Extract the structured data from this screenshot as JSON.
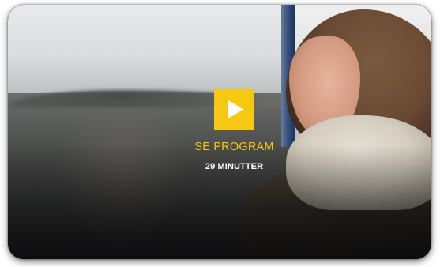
{
  "player": {
    "cta_label": "SE PROGRAM",
    "duration_label": "29 MINUTTER",
    "play_icon": "play-icon"
  },
  "colors": {
    "accent": "#f7c811",
    "duration_text": "#ffffff"
  }
}
